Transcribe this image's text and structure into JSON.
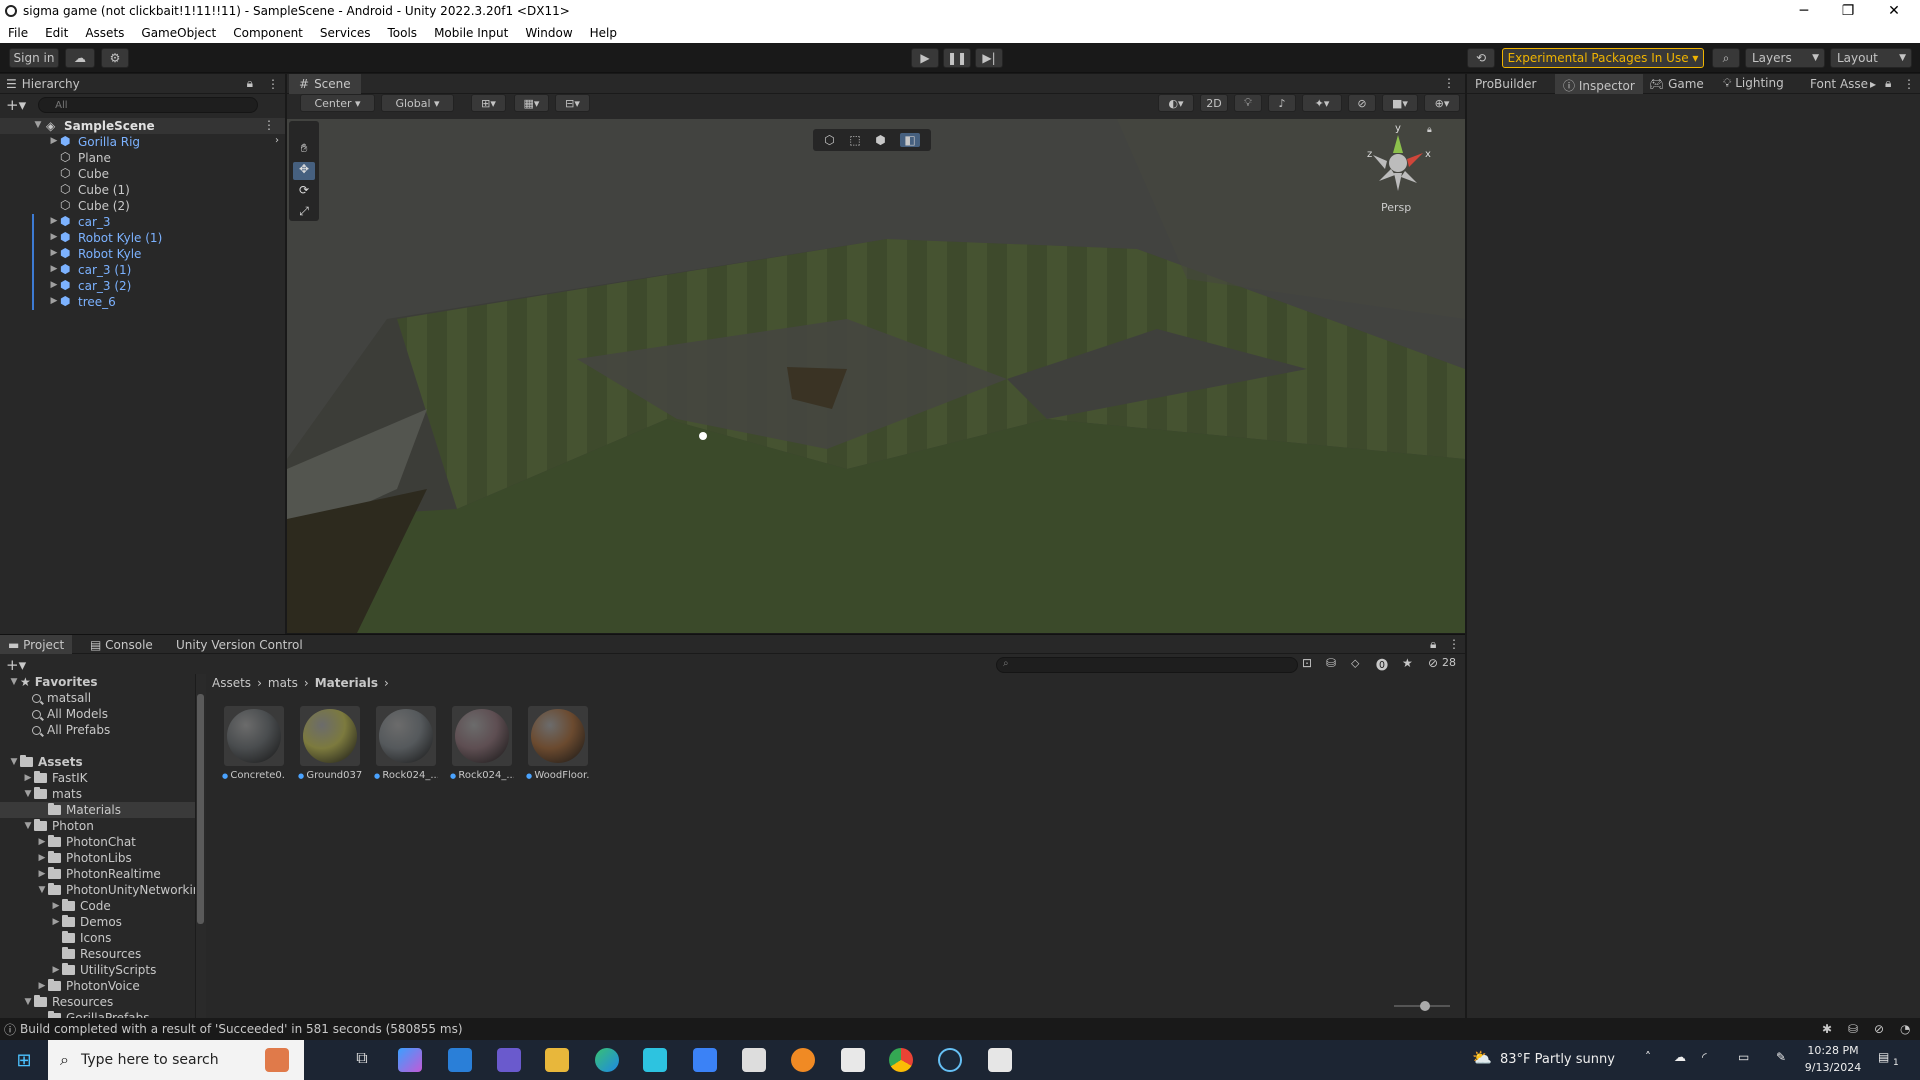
{
  "window": {
    "title": "sigma game (not clickbait!1!11!!11) - SampleScene - Android - Unity 2022.3.20f1 <DX11>",
    "min": "─",
    "max": "❐",
    "close": "✕"
  },
  "menu": [
    "File",
    "Edit",
    "Assets",
    "GameObject",
    "Component",
    "Services",
    "Tools",
    "Mobile Input",
    "Window",
    "Help"
  ],
  "toolbar": {
    "sign_in": "Sign in",
    "experimental": "Experimental Packages In Use ▾",
    "layers": "Layers",
    "layout": "Layout"
  },
  "hierarchy": {
    "title": "Hierarchy",
    "search_placeholder": "All",
    "scene": "SampleScene",
    "items": [
      {
        "label": "Gorilla Rig",
        "prefab": true,
        "arrow": true
      },
      {
        "label": "Plane",
        "prefab": false,
        "arrow": false
      },
      {
        "label": "Cube",
        "prefab": false,
        "arrow": false
      },
      {
        "label": "Cube (1)",
        "prefab": false,
        "arrow": false
      },
      {
        "label": "Cube (2)",
        "prefab": false,
        "arrow": false
      },
      {
        "label": "car_3",
        "prefab": true,
        "arrow": true
      },
      {
        "label": "Robot Kyle (1)",
        "prefab": true,
        "arrow": true
      },
      {
        "label": "Robot Kyle",
        "prefab": true,
        "arrow": true
      },
      {
        "label": "car_3 (1)",
        "prefab": true,
        "arrow": true
      },
      {
        "label": "car_3 (2)",
        "prefab": true,
        "arrow": true
      },
      {
        "label": "tree_6",
        "prefab": true,
        "arrow": true
      }
    ]
  },
  "scene": {
    "tab": "Scene",
    "pivot": "Center",
    "space": "Global",
    "mode2d": "2D",
    "persp": "Persp",
    "axis_y": "y",
    "axis_x": "x",
    "axis_z": "z"
  },
  "right_tabs": {
    "probuilder": "ProBuilder",
    "inspector": "Inspector",
    "game": "Game",
    "lighting": "Lighting",
    "font_asset": "Font Asse"
  },
  "bottom_tabs": {
    "project": "Project",
    "console": "Console",
    "uvc": "Unity Version Control"
  },
  "project": {
    "hidden_count": "28",
    "breadcrumb": [
      "Assets",
      "mats",
      "Materials"
    ],
    "favorites_label": "Favorites",
    "favorites": [
      "matsall",
      "All Models",
      "All Prefabs"
    ],
    "assets_label": "Assets",
    "tree": [
      {
        "label": "FastIK",
        "indent": 1,
        "arrow": "▶"
      },
      {
        "label": "mats",
        "indent": 1,
        "arrow": "▼"
      },
      {
        "label": "Materials",
        "indent": 2,
        "arrow": ""
      },
      {
        "label": "Photon",
        "indent": 1,
        "arrow": "▼"
      },
      {
        "label": "PhotonChat",
        "indent": 2,
        "arrow": "▶"
      },
      {
        "label": "PhotonLibs",
        "indent": 2,
        "arrow": "▶"
      },
      {
        "label": "PhotonRealtime",
        "indent": 2,
        "arrow": "▶"
      },
      {
        "label": "PhotonUnityNetworking",
        "indent": 2,
        "arrow": "▼"
      },
      {
        "label": "Code",
        "indent": 3,
        "arrow": "▶"
      },
      {
        "label": "Demos",
        "indent": 3,
        "arrow": "▶"
      },
      {
        "label": "Icons",
        "indent": 3,
        "arrow": ""
      },
      {
        "label": "Resources",
        "indent": 3,
        "arrow": ""
      },
      {
        "label": "UtilityScripts",
        "indent": 3,
        "arrow": "▶"
      },
      {
        "label": "PhotonVoice",
        "indent": 2,
        "arrow": "▶"
      },
      {
        "label": "Resources",
        "indent": 1,
        "arrow": "▼"
      },
      {
        "label": "GorillaPrefabs",
        "indent": 2,
        "arrow": ""
      }
    ],
    "assets": [
      {
        "label": "Concrete0...",
        "color": "#4a4d4f"
      },
      {
        "label": "Ground037...",
        "color": "#7c7a3e"
      },
      {
        "label": "Rock024_...",
        "color": "#55595c"
      },
      {
        "label": "Rock024_...",
        "color": "#5e4e52"
      },
      {
        "label": "WoodFloor...",
        "color": "#6b4a2f"
      }
    ]
  },
  "status": {
    "message": "Build completed with a result of 'Succeeded' in 581 seconds (580855 ms)"
  },
  "taskbar": {
    "search_placeholder": "Type here to search",
    "weather": "83°F  Partly sunny",
    "time": "10:28 PM",
    "date": "9/13/2024",
    "notif": "1"
  }
}
